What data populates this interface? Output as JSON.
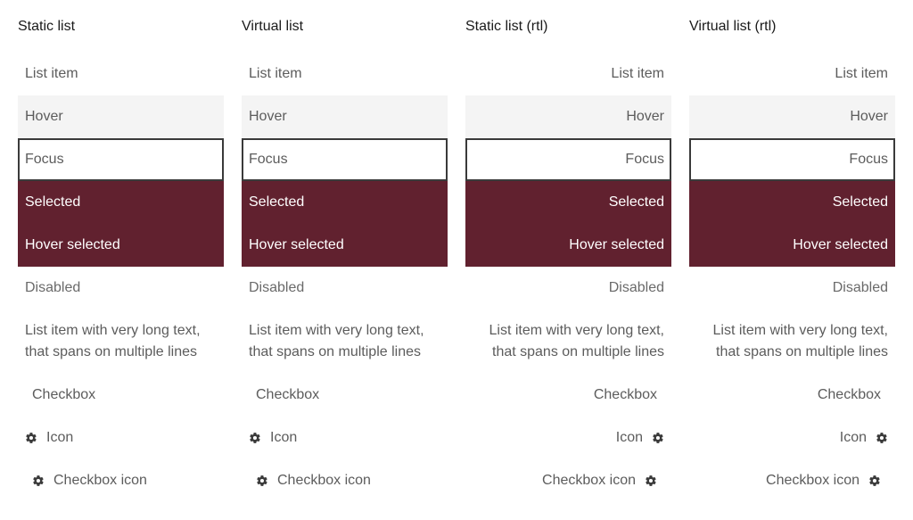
{
  "colors": {
    "selected_bg": "#61212f",
    "hover_bg": "#f4f4f4",
    "focus_border": "#3a3a3a",
    "text": "#5c5c5c",
    "title_text": "#1a1a1a"
  },
  "columns": [
    {
      "title": "Static list",
      "direction": "ltr",
      "items": {
        "default": "List item",
        "hover": "Hover",
        "focus": "Focus",
        "selected": "Selected",
        "hover_selected": "Hover selected",
        "disabled": "Disabled",
        "multiline": "List item with very long text, that spans on multiple lines",
        "checkbox": "Checkbox",
        "icon": "Icon",
        "checkbox_icon": "Checkbox icon"
      }
    },
    {
      "title": "Virtual list",
      "direction": "ltr",
      "items": {
        "default": "List item",
        "hover": "Hover",
        "focus": "Focus",
        "selected": "Selected",
        "hover_selected": "Hover selected",
        "disabled": "Disabled",
        "multiline": "List item with very long text, that spans on multiple lines",
        "checkbox": "Checkbox",
        "icon": "Icon",
        "checkbox_icon": "Checkbox icon"
      }
    },
    {
      "title": "Static list (rtl)",
      "direction": "rtl",
      "items": {
        "default": "List item",
        "hover": "Hover",
        "focus": "Focus",
        "selected": "Selected",
        "hover_selected": "Hover selected",
        "disabled": "Disabled",
        "multiline": "List item with very long text, that spans on multiple lines",
        "checkbox": "Checkbox",
        "icon": "Icon",
        "checkbox_icon": "Checkbox icon"
      }
    },
    {
      "title": "Virtual list (rtl)",
      "direction": "rtl",
      "items": {
        "default": "List item",
        "hover": "Hover",
        "focus": "Focus",
        "selected": "Selected",
        "hover_selected": "Hover selected",
        "disabled": "Disabled",
        "multiline": "List item with very long text, that spans on multiple lines",
        "checkbox": "Checkbox",
        "icon": "Icon",
        "checkbox_icon": "Checkbox icon"
      }
    }
  ],
  "icons": {
    "item_icon": "gear-icon"
  }
}
